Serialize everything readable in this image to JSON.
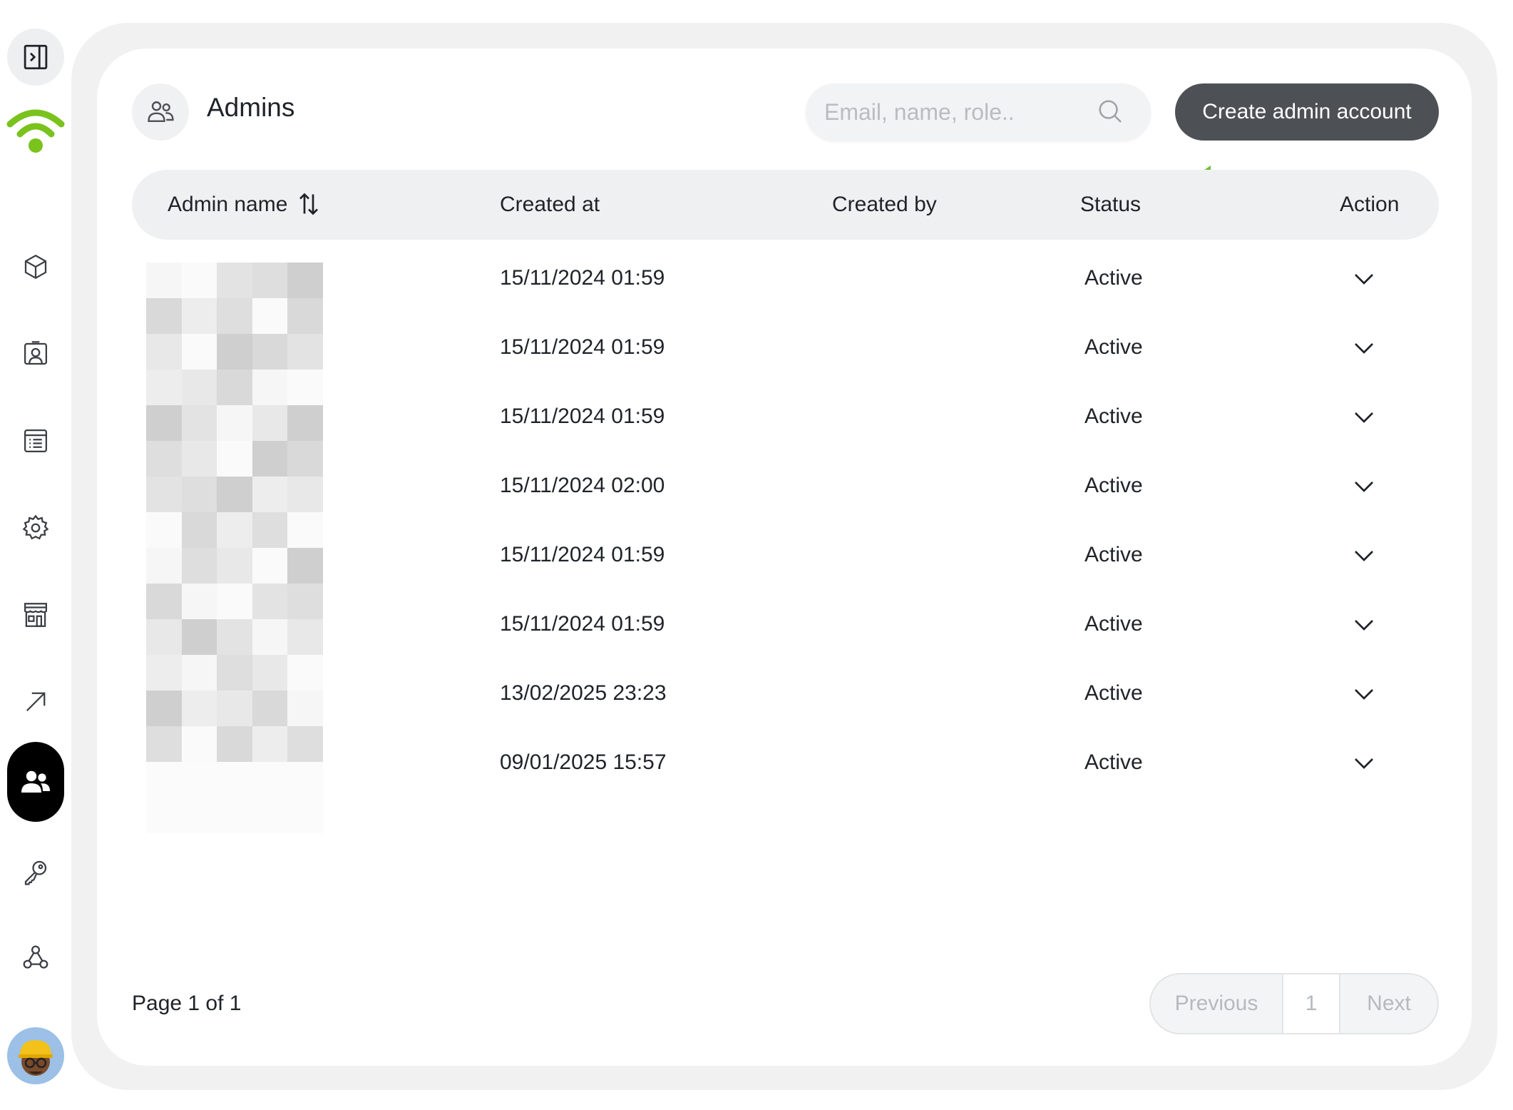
{
  "colors": {
    "accent_green": "#7ac21c",
    "button_dark": "#4d5055",
    "annotation_arrow": "#6cbf35"
  },
  "sidebar": {
    "items": [
      {
        "icon": "panel-toggle-icon"
      },
      {
        "icon": "wifi-logo-icon"
      },
      {
        "icon": "cube-icon"
      },
      {
        "icon": "contact-card-icon"
      },
      {
        "icon": "list-icon"
      },
      {
        "icon": "gear-icon"
      },
      {
        "icon": "store-icon"
      },
      {
        "icon": "arrow-up-right-icon"
      },
      {
        "icon": "users-icon",
        "active": true
      },
      {
        "icon": "key-icon"
      },
      {
        "icon": "webhook-icon"
      },
      {
        "icon": "avatar"
      }
    ]
  },
  "header": {
    "title": "Admins",
    "search_placeholder": "Email, name, role..",
    "create_button": "Create admin account"
  },
  "table": {
    "columns": [
      "Admin name",
      "Created at",
      "Created by",
      "Status",
      "Action"
    ],
    "rows": [
      {
        "created_at": "15/11/2024 01:59",
        "status": "Active"
      },
      {
        "created_at": "15/11/2024 01:59",
        "status": "Active"
      },
      {
        "created_at": "15/11/2024 01:59",
        "status": "Active"
      },
      {
        "created_at": "15/11/2024 02:00",
        "status": "Active"
      },
      {
        "created_at": "15/11/2024 01:59",
        "status": "Active"
      },
      {
        "created_at": "15/11/2024 01:59",
        "status": "Active"
      },
      {
        "created_at": "13/02/2025 23:23",
        "status": "Active"
      },
      {
        "created_at": "09/01/2025 15:57",
        "status": "Active"
      }
    ]
  },
  "footer": {
    "page_info": "Page 1 of 1",
    "previous": "Previous",
    "current_page": "1",
    "next": "Next"
  }
}
